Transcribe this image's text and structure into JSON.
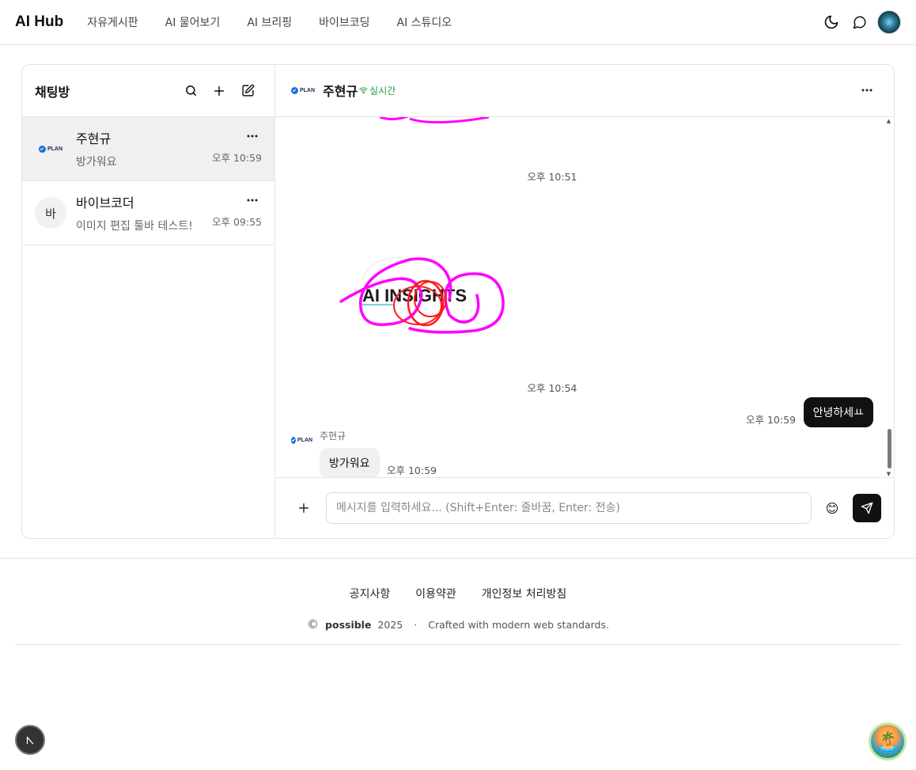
{
  "nav": {
    "brand": "AI Hub",
    "links": [
      "자유게시판",
      "AI 물어보기",
      "AI 브리핑",
      "바이브코딩",
      "AI 스튜디오"
    ]
  },
  "sidebar": {
    "title": "채팅방",
    "rooms": [
      {
        "name": "주현규",
        "preview": "방가워요",
        "time": "오후 10:59",
        "avatar": "PLAN",
        "active": true
      },
      {
        "name": "바이브코더",
        "preview": "이미지 편집 툴바 테스트!",
        "time": "오후 09:55",
        "avatar": "바",
        "active": false
      }
    ]
  },
  "chat": {
    "title": "주현규",
    "status": "실시간",
    "avatar": "PLAN",
    "sketch_text": "AI INSIGHTS",
    "timestamps": [
      "오후 10:51",
      "오후 10:54"
    ],
    "outgoing": {
      "text": "안녕하세ㅛ",
      "time": "오후 10:59"
    },
    "incoming": {
      "sender": "주현규",
      "text": "방가워요",
      "time": "오후 10:59"
    },
    "composer_placeholder": "메시지를 입력하세요... (Shift+Enter: 줄바꿈, Enter: 전송)",
    "emoji": "😊"
  },
  "footer": {
    "links": [
      "공지사항",
      "이용약관",
      "개인정보 처리방침"
    ],
    "copyright_symbol": "©",
    "company": "possible",
    "year": "2025",
    "separator": "·",
    "tagline": "Crafted with modern web standards."
  },
  "colors": {
    "accent": "#111111",
    "live": "#2a9d3c",
    "sketch_magenta": "#ff00ff",
    "sketch_red": "#ff1a1a"
  }
}
